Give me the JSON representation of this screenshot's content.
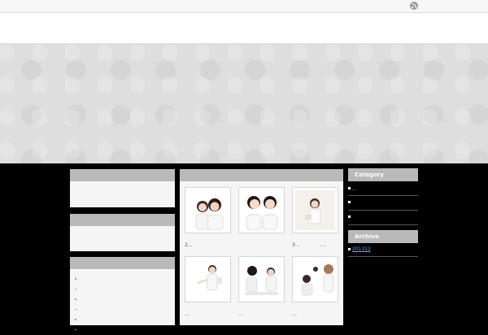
{
  "icons": {
    "feed": "rss-icon"
  },
  "sidebar_left": {
    "list_item_count": 7
  },
  "main": {
    "thumbs": [
      {
        "scene": "two nurses smiling",
        "caption": ""
      },
      {
        "scene": "two nurses smiling close-up",
        "caption": ""
      },
      {
        "scene": "nurse with clipboard",
        "caption": ""
      },
      {
        "scene": "nurse gesturing",
        "caption": ""
      },
      {
        "scene": "consultation at desk",
        "caption": ""
      },
      {
        "scene": "patient care scene",
        "caption": ""
      }
    ],
    "captions": {
      "c1": "2...",
      "c3a": "3...",
      "c3b": "....",
      "c4": "...",
      "c5": "...",
      "c6": "..."
    }
  },
  "sidebar_right": {
    "category_title": "Category",
    "category_items": [
      "...",
      "",
      ""
    ],
    "archive_title": "Archive",
    "archive_items": [
      "201312"
    ]
  }
}
